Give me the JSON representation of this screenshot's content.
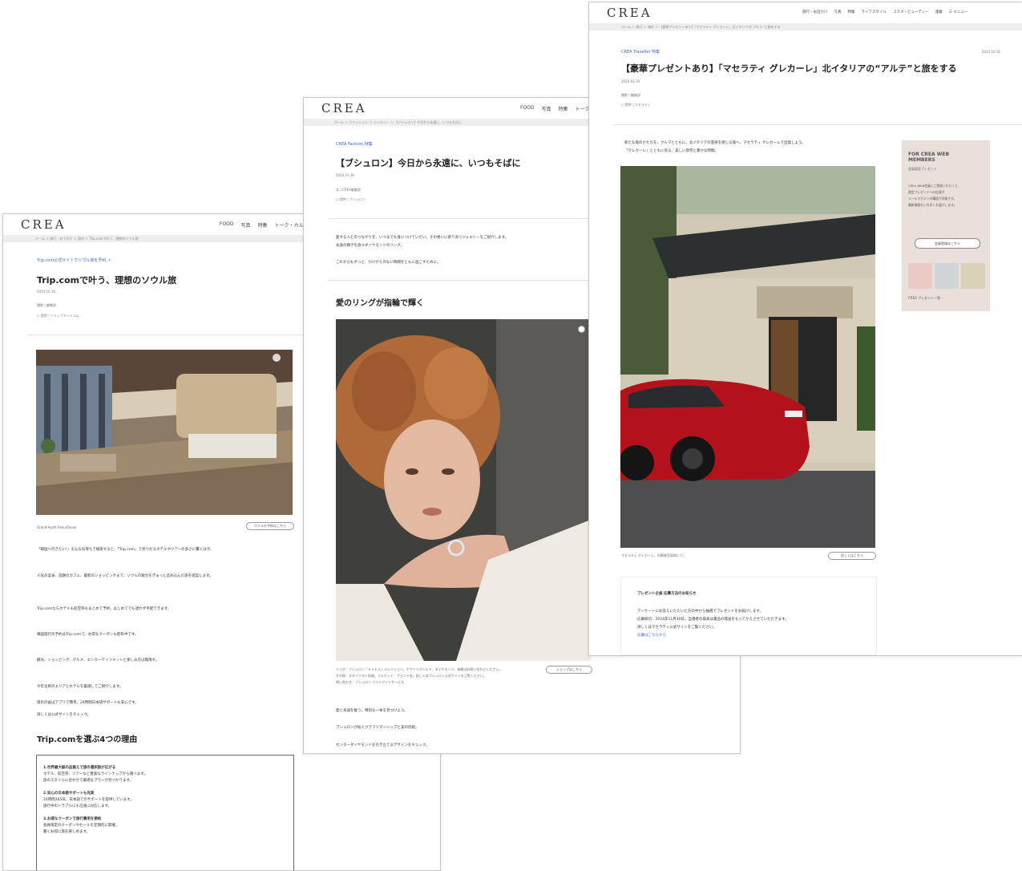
{
  "brand": {
    "logo": "CREA"
  },
  "page_left": {
    "nav": [
      "FOOD",
      "写真",
      "特集",
      "トーク・カル"
    ],
    "breadcrumb": "ホーム ＞ 旅行・おでかけ ＞ 国内 ＞ Trip.comで叶う、理想のソウル旅",
    "section": "Trip.com公式サイトでソウル旅を予約",
    "title": "Trip.comで叶う、理想のソウル旅",
    "date": "2024.10.16",
    "author": "撮影＝編集部",
    "credit": "提供＝トリップドットコム",
    "caption": "Grand Hyatt Seoul/Seoul",
    "photo_button": "ホテルの予約はこちら",
    "paragraphs": [
      "「韓国へ行きたい!」そんな気持ちで検索すると、「Trip.com」で見つかるホテルやツアーの多さに驚くはず。",
      "人気の美食、話題のカフェ、最新のショッピングまで、ソウルの魅力をぎゅっと詰め込んだ旅を提案します。",
      "Trip.comならホテルも航空券もまとめて予約。はじめてでも迷わず手配できます。",
      "韓国旅行の予約はTrip.comで。お得なクーポンも配布中です。",
      "観光、ショッピング、グルメ、エンターテインメントと楽しみ方は無限大。",
      "今年注目のエリアとホテルを厳選してご紹介します。",
      "旅の計画はアプリで簡単。24時間日本語サポートも安心です。",
      "詳しくは公式サイトをチェック。"
    ],
    "reasons_heading": "Trip.comを選ぶ4つの理由",
    "reasons": [
      {
        "title": "1.世界最大級の品揃えで旅の選択肢が広がる",
        "lines": [
          "ホテル、航空券、ツアーなど豊富なラインナップから選べます。",
          "旅のスタイルに合わせて最適なプランが見つかります。"
        ]
      },
      {
        "title": "2.安心の日本語サポートも充実",
        "lines": [
          "24時間365日、日本語でのサポートを提供しています。",
          "旅行中のトラブルにも迅速に対応します。"
        ]
      },
      {
        "title": "3.お得なクーポンで旅行費用を節約",
        "lines": [
          "会員限定のクーポンやセールを定期的に開催。",
          "賢くお得に旅を楽しめます。"
        ]
      }
    ]
  },
  "page_mid": {
    "nav": [
      "FOOD",
      "写真",
      "特集",
      "トーク"
    ],
    "breadcrumb": "ホーム ＞ ファッション ＞ ジュエリー ＞ 【ブシュロン】今日から永遠に、いつもそばに",
    "section": "CREA Fashion 特集",
    "title": "【ブシュロン】今日から永遠に、いつもそばに",
    "date": "2024.10.16",
    "author": "文＝CREA編集部",
    "credit": "提供＝ブシュロン",
    "intro": [
      "愛する人とのつながりを、いつまでも身につけていたい。その想いに寄り添うジュエリーをご紹介します。",
      "永遠の輝きを放つダイヤモンドのリング。",
      "これからもずっと、かけがえのない時間をともに過ごすために。"
    ],
    "subheading": "愛のリングが指輪で輝く",
    "caption_lines": [
      "リング：ブシュロン「キャトル」コレクション。ホワイトゴールド、ダイヤモンド。価格はお問い合わせください。",
      "その他：スタイリスト私物。ジャケット：ブランド名。詳しくはブシュロン公式サイトをご覧ください。",
      "問い合わせ：ブシュロン クライアントサービス"
    ],
    "photo_button": "ショップはこちら",
    "body": [
      "愛と永遠を誓う、特別な一本を見つけよう。",
      "ブシュロンが紡ぐクラフツマンシップと美の伝統。",
      "センターダイヤモンドを引き立てるデザインをチェック。"
    ]
  },
  "page_right": {
    "nav": [
      "旅行・お出かけ",
      "写真",
      "特集",
      "ライフスタイル",
      "コスメ・ビューティー",
      "連載",
      "メニュー"
    ],
    "breadcrumb": "ホーム ＞ 旅行 ＞ 海外 ＞ 【豪華プレゼントあり】「マセラティ グレカーレ」北イタリアの“アルテ”と旅をする",
    "section": "CREA Traveller 特集",
    "date_top": "2024.10.16",
    "title": "【豪華プレゼントあり】「マセラティ グレカーレ」北イタリアの“アルテ”と旅をする",
    "date": "2024.10.16",
    "author": "撮影＝編集部",
    "credit": "提供＝マセラティ",
    "intro": [
      "新たな旅のかたちを、クルマとともに。北イタリアの芸術を感じる旅へ、マセラティ グレカーレで出発しよう。",
      "「グレカーレ」とともに巡る、美しい邸宅と豊かな時間。"
    ],
    "caption": "マセラティ グレカーレ、旧朝香宮邸前にて。",
    "photo_button": "詳しくはこちら",
    "present_heading": "プレゼント企画 応募方法のお知らせ",
    "present_lines": [
      "アンケートにお答えいただいた方の中から抽選でプレゼントをお届けします。",
      "応募締切：2024年11月30日。当選者の発表は賞品の発送をもってかえさせていただきます。",
      "詳しくはマセラティ公式サイトをご覧ください。"
    ],
    "present_link": "応募はこちらから",
    "sidebar": {
      "title_line1": "FOR CREA WEB",
      "title_line2": "MEMBERS",
      "subtitle": "会員限定プレゼント",
      "lines": [
        "CREA WEB会員にご登録いただくと、",
        "限定プレゼントへの応募や",
        "メールマガジンの購読が可能です。",
        "最新情報をいち早くお届けします。"
      ],
      "button": "会員登録はこちら",
      "footer": "CREA プレゼント一覧"
    }
  }
}
